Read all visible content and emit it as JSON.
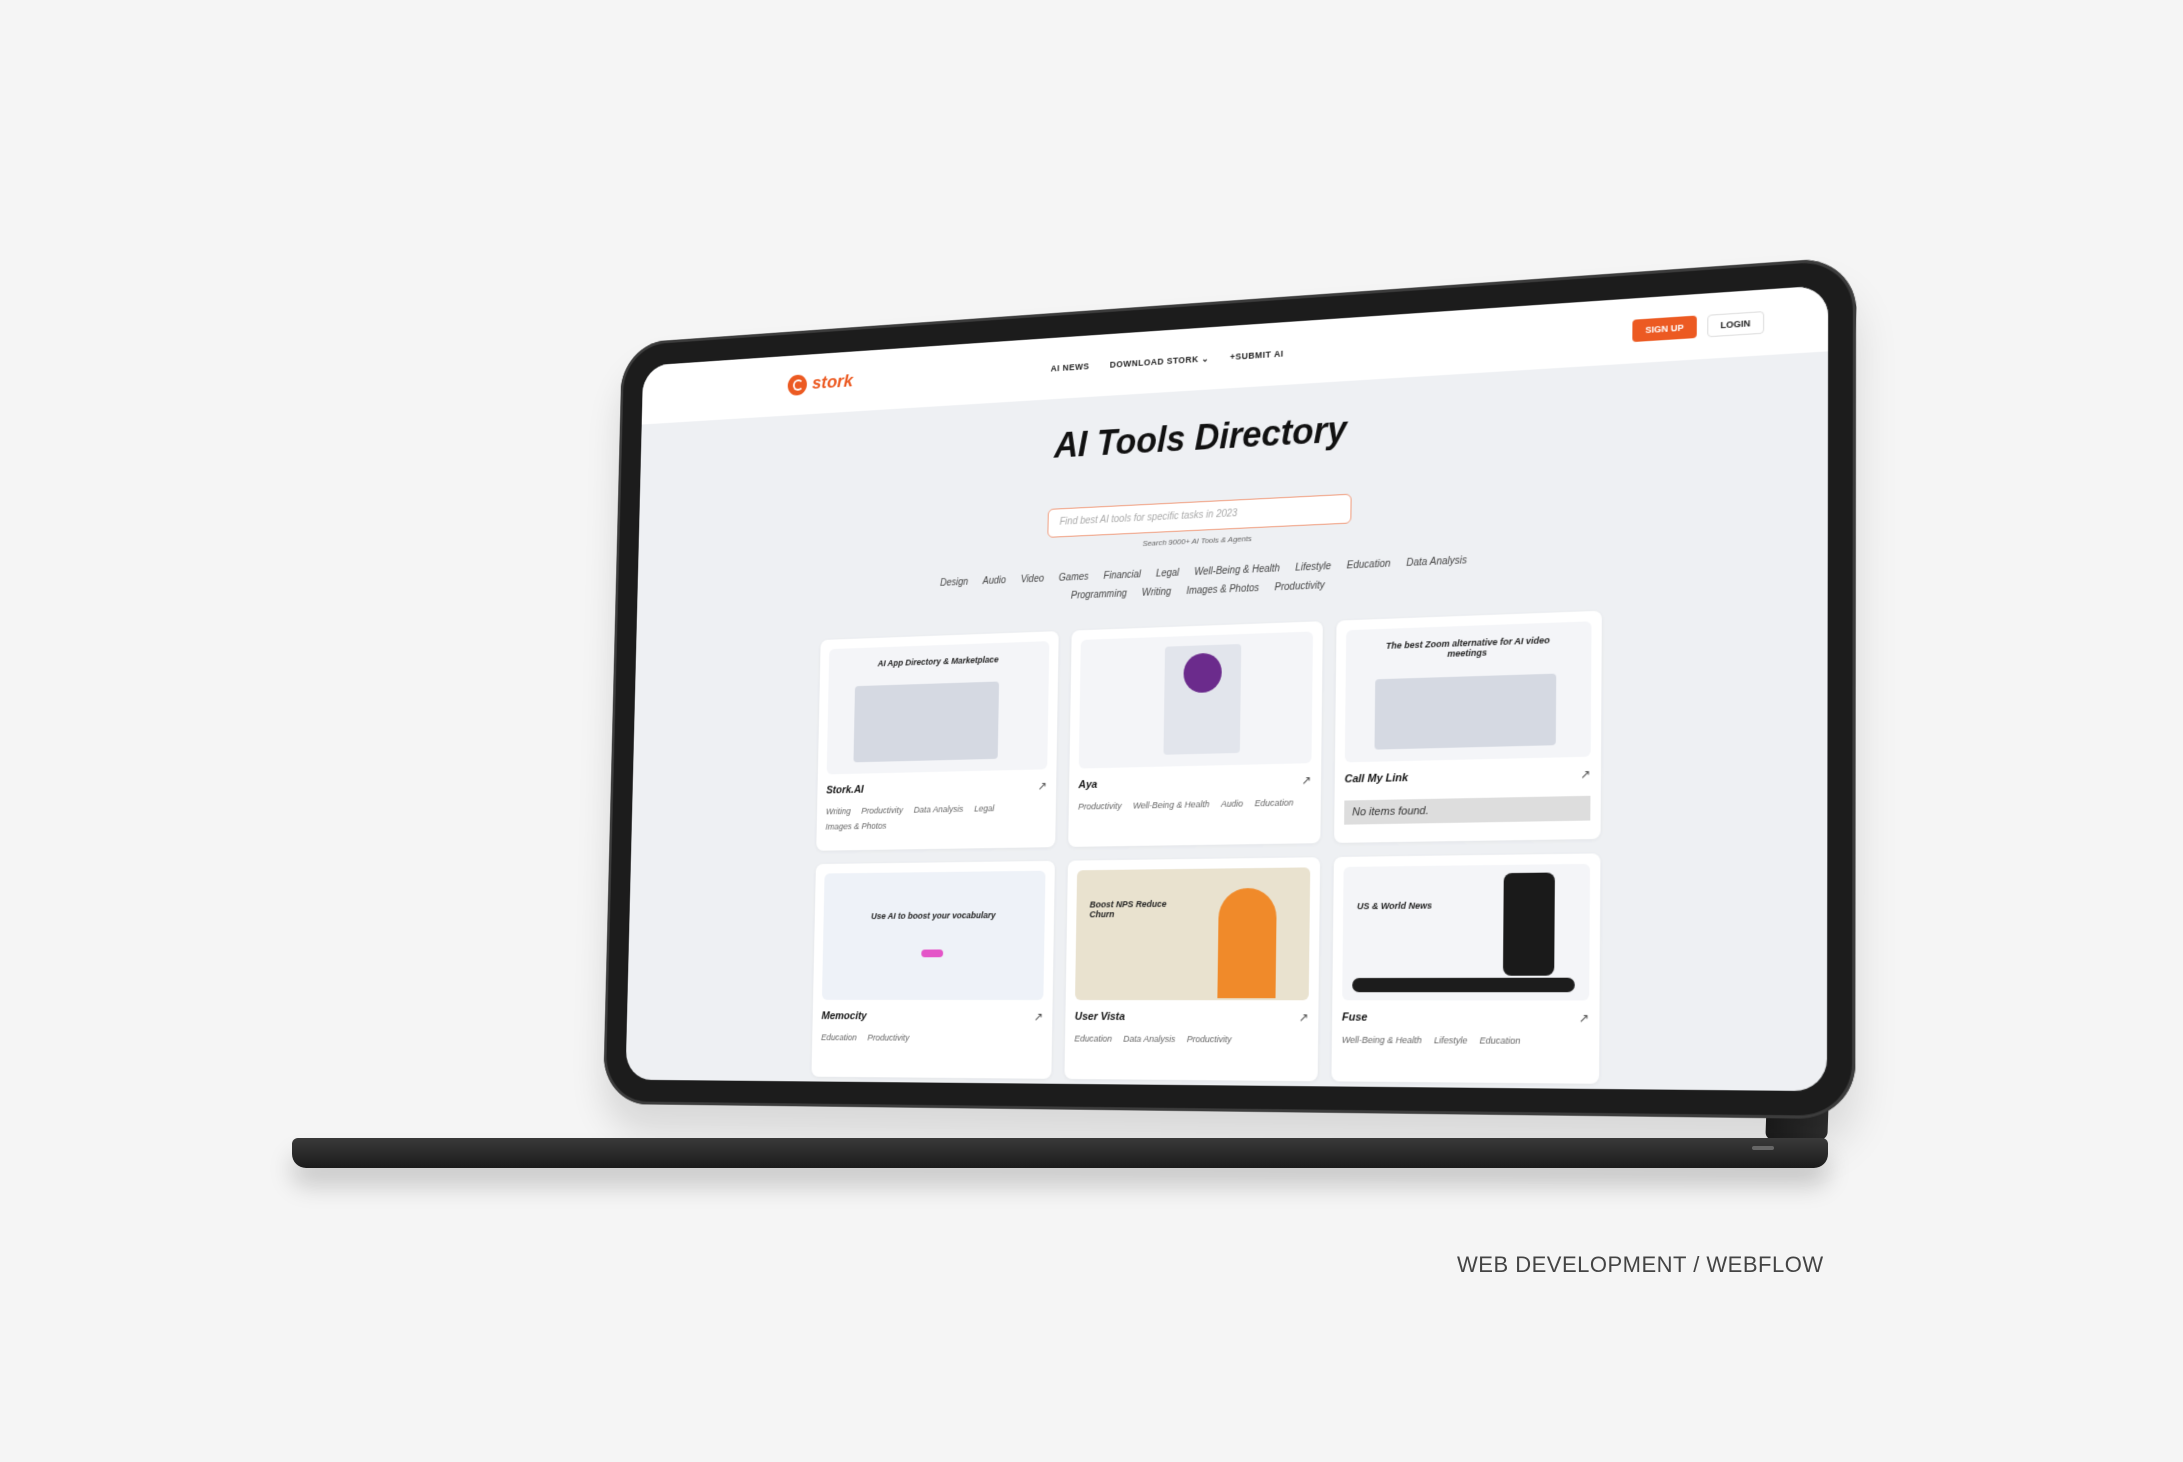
{
  "site": {
    "logo_text": "stork",
    "nav": [
      "AI NEWS",
      "DOWNLOAD STORK ⌄",
      "+SUBMIT AI"
    ],
    "signup_label": "SIGN UP",
    "login_label": "LOGIN"
  },
  "hero": {
    "title": "AI Tools Directory",
    "search_placeholder": "Find best AI tools for specific tasks in 2023",
    "search_hint": "Search 9000+ AI Tools & Agents"
  },
  "categories": [
    "Design",
    "Audio",
    "Video",
    "Games",
    "Financial",
    "Legal",
    "Well-Being & Health",
    "Lifestyle",
    "Education",
    "Data Analysis",
    "Programming",
    "Writing",
    "Images & Photos",
    "Productivity"
  ],
  "cards": [
    {
      "title": "Stork.AI",
      "caption": "AI App Directory & Marketplace",
      "tags": [
        "Writing",
        "Productivity",
        "Data Analysis",
        "Legal",
        "Images & Photos"
      ]
    },
    {
      "title": "Aya",
      "caption": "",
      "tags": [
        "Productivity",
        "Well-Being & Health",
        "Audio",
        "Education"
      ]
    },
    {
      "title": "Call My Link",
      "caption": "The best Zoom alternative for AI video meetings",
      "tags": [],
      "empty": "No items found."
    },
    {
      "title": "Memocity",
      "caption": "Use AI to boost your vocabulary",
      "tags": [
        "Education",
        "Productivity"
      ]
    },
    {
      "title": "User Vista",
      "caption": "Boost NPS Reduce Churn",
      "tags": [
        "Education",
        "Data Analysis",
        "Productivity"
      ]
    },
    {
      "title": "Fuse",
      "caption": "US & World News",
      "tags": [
        "Well-Being & Health",
        "Lifestyle",
        "Education"
      ]
    }
  ],
  "caption": "WEB DEVELOPMENT / WEBFLOW"
}
